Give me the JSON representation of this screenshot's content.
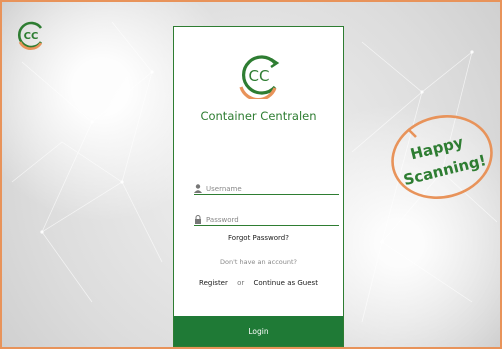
{
  "brand": {
    "name": "Container Centralen",
    "logo_text": "CC"
  },
  "form": {
    "username_placeholder": "Username",
    "password_placeholder": "Password",
    "forgot_password": "Forgot Password?",
    "no_account": "Don't have an account?",
    "register": "Register",
    "or": "or",
    "guest": "Continue as Guest",
    "login": "Login"
  },
  "sticker": {
    "line1": "Happy",
    "line2": "Scanning!"
  },
  "colors": {
    "accent_green": "#1f7a36",
    "accent_orange": "#e8935a",
    "frame": "#e8935a"
  },
  "icons": {
    "username": "user-icon",
    "password": "lock-icon"
  }
}
